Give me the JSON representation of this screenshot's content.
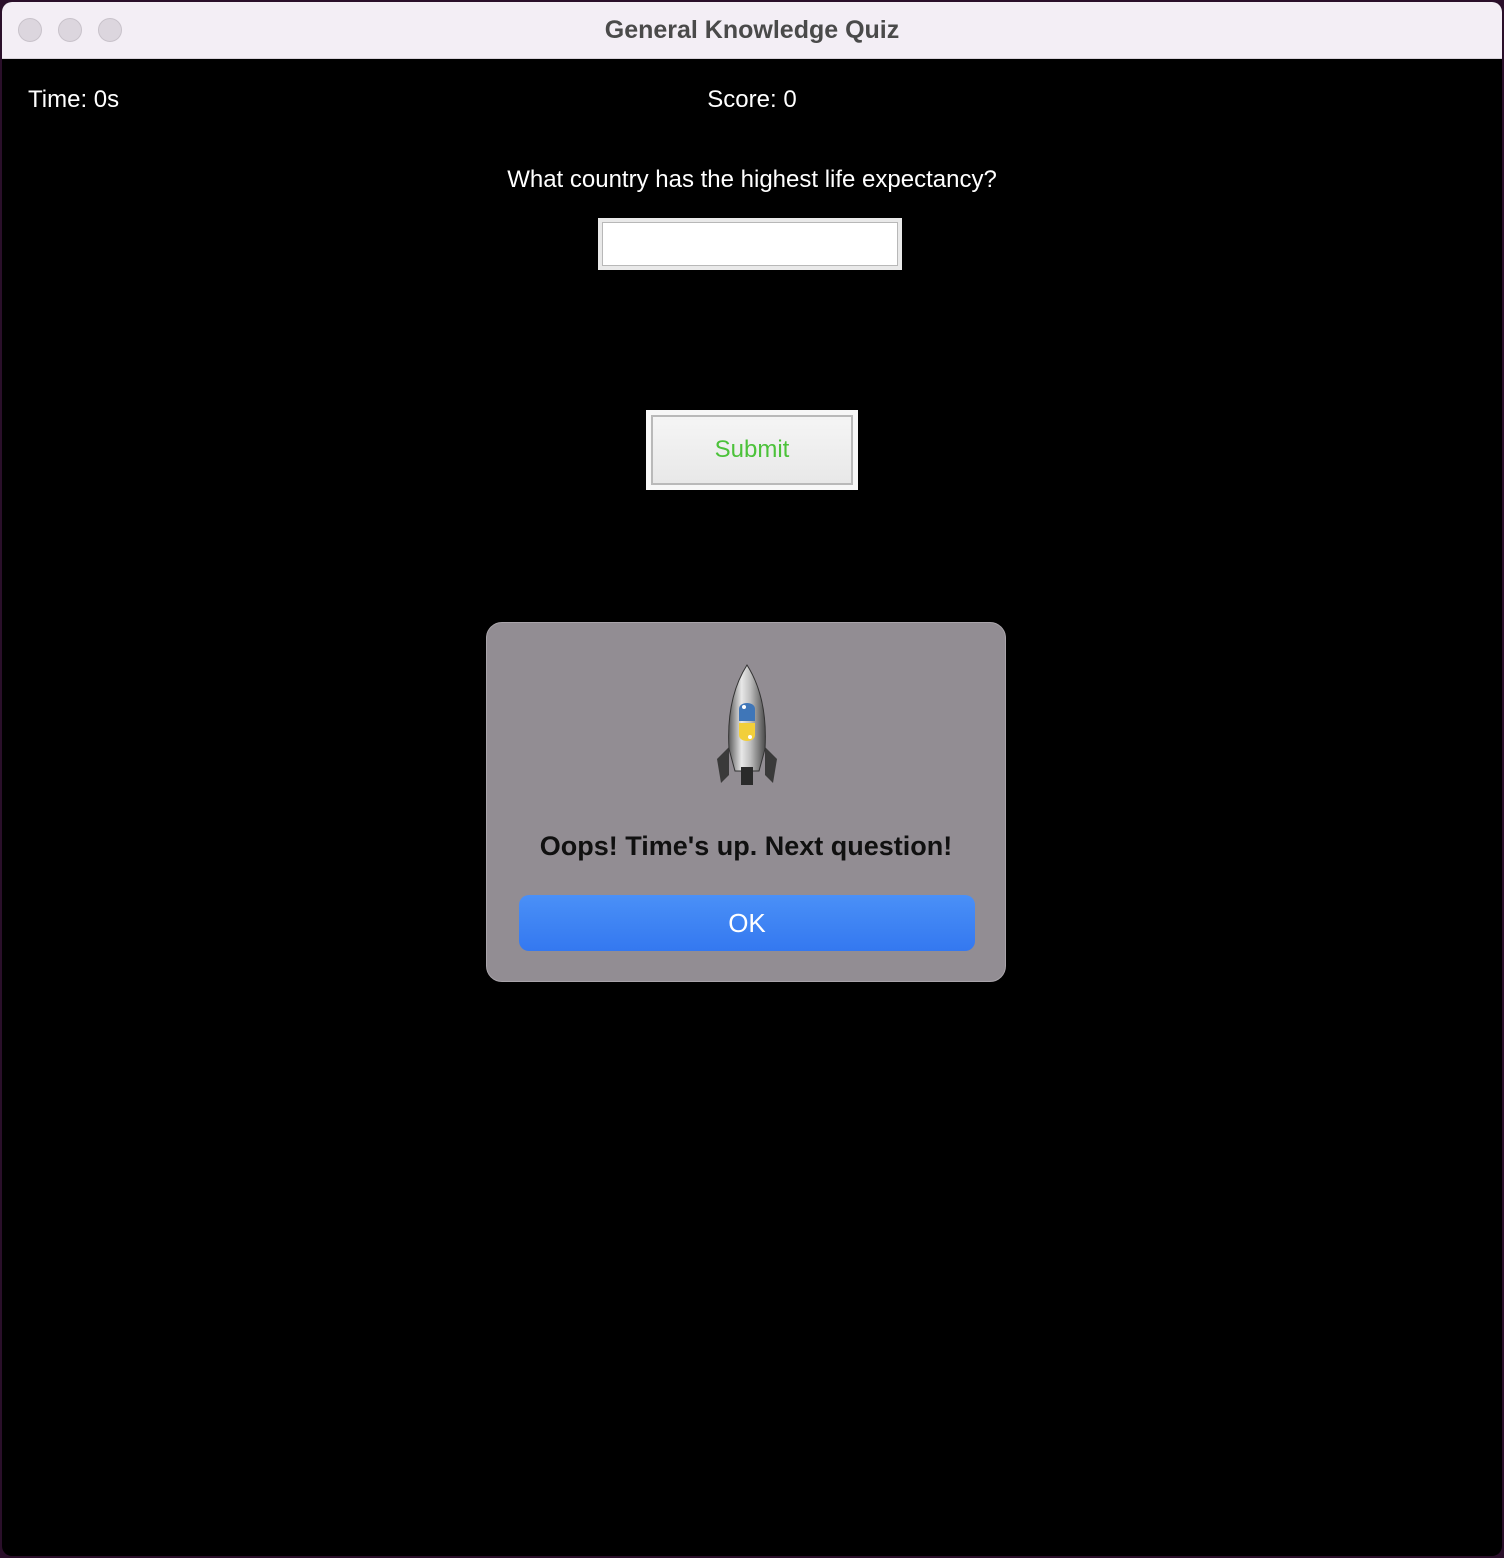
{
  "window": {
    "title": "General Knowledge Quiz"
  },
  "status": {
    "time": "Time: 0s",
    "score": "Score: 0"
  },
  "quiz": {
    "question": "What country has the highest life expectancy?",
    "answer_value": "",
    "submit_label": "Submit",
    "submit_text_color": "#4cc23a"
  },
  "dialog": {
    "icon": "python-rocket-icon",
    "message": "Oops! Time's up. Next question!",
    "ok_label": "OK",
    "ok_color": "#3b82f6"
  }
}
